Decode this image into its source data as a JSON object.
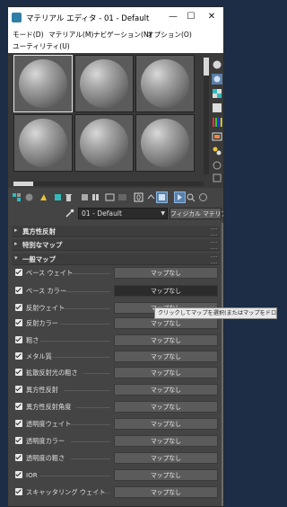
{
  "window": {
    "title": "マテリアル エディタ - 01 - Default",
    "minimize_glyph": "—",
    "maximize_glyph": "☐",
    "close_glyph": "✕"
  },
  "menu": {
    "row1": [
      "モード(D)",
      "マテリアル(M)",
      "ナビゲーション(N)",
      "オプション(O)"
    ],
    "row2": [
      "ユーティリティ(U)"
    ]
  },
  "material": {
    "name": "01 - Default",
    "type_button": "フィジカル マテリアル",
    "eyedropper_icon": "eyedropper-icon"
  },
  "rollouts": {
    "anisotropy": {
      "label": "異方性反射",
      "expanded": false
    },
    "special": {
      "label": "特別なマップ",
      "expanded": false
    },
    "general": {
      "label": "一般マップ",
      "expanded": true
    }
  },
  "map_rows": [
    {
      "label": "ベース ウェイト",
      "button": "マップなし",
      "checked": true
    },
    {
      "label": "ベース カラー",
      "button": "マップなし",
      "checked": true,
      "highlight": true
    },
    {
      "label": "反射ウェイト",
      "button": "マップなし",
      "checked": true
    },
    {
      "label": "反射カラー",
      "button": "マップなし",
      "checked": true
    },
    {
      "label": "粗さ",
      "button": "マップなし",
      "checked": true
    },
    {
      "label": "メタル質",
      "button": "マップなし",
      "checked": true
    },
    {
      "label": "拡散反射光の粗さ",
      "button": "マップなし",
      "checked": true
    },
    {
      "label": "異方性反射",
      "button": "マップなし",
      "checked": true
    },
    {
      "label": "異方性反射角度",
      "button": "マップなし",
      "checked": true
    },
    {
      "label": "透明度ウェイト",
      "button": "マップなし",
      "checked": true
    },
    {
      "label": "透明度カラー",
      "button": "マップなし",
      "checked": true
    },
    {
      "label": "透明度の粗さ",
      "button": "マップなし",
      "checked": true
    },
    {
      "label": "IOR",
      "button": "マップなし",
      "checked": true
    },
    {
      "label": "スキャッタリング ウェイト",
      "button": "マップなし",
      "checked": true
    }
  ],
  "tooltip": "クリックしてマップを選択(またはマップをドロップ)",
  "toolbar_icons": [
    "get-material-icon",
    "put-to-scene-icon",
    "assign-to-selection-icon",
    "reset-map-icon",
    "delete-icon",
    "make-unique-icon",
    "put-to-library-icon",
    "material-id-channel-icon",
    "show-shaded-icon",
    "show-end-result-icon",
    "go-to-parent-icon",
    "go-forward-sibling-icon",
    "pick-from-object-icon"
  ],
  "side_icons": [
    "sample-type-icon",
    "backlight-icon",
    "background-icon",
    "sample-uv-tiling-icon",
    "video-color-check-icon",
    "make-preview-icon",
    "options-icon",
    "select-by-material-icon",
    "material-navigator-icon"
  ],
  "colors": {
    "accent": "#5a7fa8",
    "panel": "#444444",
    "desktop": "#1c2d45"
  }
}
